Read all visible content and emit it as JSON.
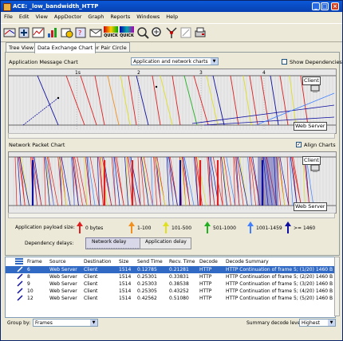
{
  "window": {
    "title": "ACE: _low_bandwidth_HTTP"
  },
  "menu": [
    "File",
    "Edit",
    "View",
    "AppDoctor",
    "Graph",
    "Reports",
    "Windows",
    "Help"
  ],
  "toolbar": {
    "quick1": "QUICK",
    "quick2": "QUICK",
    "icons": [
      "open-capture",
      "import",
      "filter",
      "statistics",
      "decode",
      "query",
      "mail",
      "quick-view",
      "quick-decode",
      "find",
      "zoom-in",
      "zoom-out",
      "merge",
      "time-plot",
      "print"
    ]
  },
  "tabs": [
    "Tree View",
    "Data Exchange Chart",
    "Tier Pair Circle"
  ],
  "app_chart": {
    "label": "Application Message Chart",
    "combo_value": "Application and network charts",
    "show_deps_label": "Show Dependencies",
    "ticks": [
      "1s",
      "2",
      "3",
      "4"
    ],
    "client_label": "Client",
    "server_label": "Web Server"
  },
  "net_chart": {
    "label": "Network Packet Chart",
    "align_label": "Align Charts",
    "client_label": "Client",
    "server_label": "Web Server"
  },
  "legend": {
    "payload_label": "Application payload size:",
    "items": [
      {
        "label": "0 bytes",
        "color": "#e02020"
      },
      {
        "label": "1-100",
        "color": "#f09020"
      },
      {
        "label": "101-500",
        "color": "#e0e020"
      },
      {
        "label": "501-1000",
        "color": "#20b020"
      },
      {
        "label": "1001-1459",
        "color": "#4080ff"
      },
      {
        "label": ">= 1460",
        "color": "#1010a0"
      }
    ],
    "delays_label": "Dependency delays:",
    "network_delay": "Network delay",
    "application_delay": "Application delay"
  },
  "table": {
    "headers": [
      "Frame",
      "Source",
      "Destination",
      "Size",
      "Send Time",
      "Recv. Time",
      "Decode",
      "Decode Summary"
    ],
    "rows": [
      [
        "6",
        "Web Server",
        "Client",
        "1514",
        "0.12785",
        "0.21281",
        "HTTP",
        "HTTP Continuation of frame 5; (1/20) 1460 B"
      ],
      [
        "8",
        "Web Server",
        "Client",
        "1514",
        "0.25301",
        "0.33831",
        "HTTP",
        "HTTP Continuation of frame 5; (2/20) 1460 B"
      ],
      [
        "9",
        "Web Server",
        "Client",
        "1514",
        "0.25303",
        "0.38538",
        "HTTP",
        "HTTP Continuation of frame 5; (3/20) 1460 B"
      ],
      [
        "10",
        "Web Server",
        "Client",
        "1514",
        "0.25305",
        "0.43252",
        "HTTP",
        "HTTP Continuation of frame 5; (4/20) 1460 B"
      ],
      [
        "12",
        "Web Server",
        "Client",
        "1514",
        "0.42562",
        "0.51080",
        "HTTP",
        "HTTP Continuation of frame 5; (5/20) 1460 B"
      ]
    ]
  },
  "footer": {
    "group_by_label": "Group by:",
    "group_by_value": "Frames",
    "summary_label": "Summary decode level",
    "summary_value": "Highest"
  }
}
